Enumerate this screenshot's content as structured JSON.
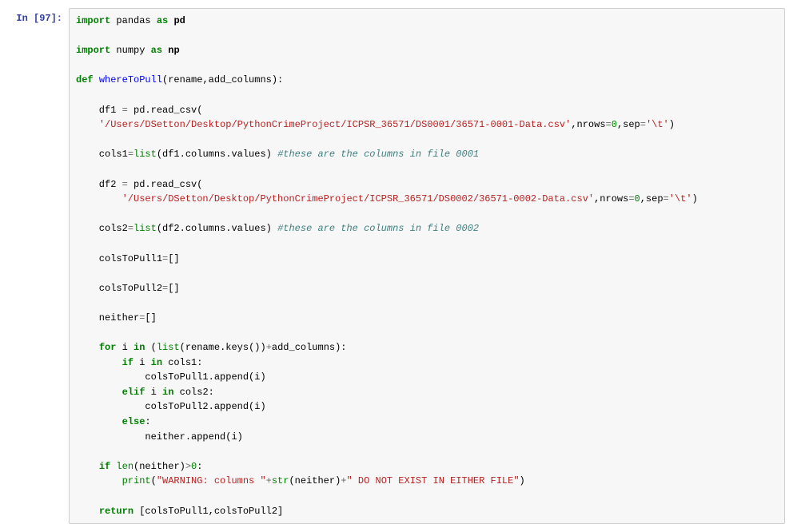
{
  "prompt": "In [97]:",
  "code": {
    "line1_import": "import",
    "line1_pandas": "pandas",
    "line1_as": "as",
    "line1_pd": "pd",
    "line2_import": "import",
    "line2_numpy": "numpy",
    "line2_as": "as",
    "line2_np": "np",
    "def": "def",
    "funcname": "whereToPull",
    "params": "(rename,add_columns):",
    "df1_assign": "    df1 ",
    "eq": "=",
    "pd_read_csv": " pd",
    "dot_read_csv": ".read_csv(",
    "path1": "'/Users/DSetton/Desktop/PythonCrimeProject/ICPSR_36571/DS0001/36571-0001-Data.csv'",
    "nrows": ",nrows",
    "zero": "0",
    "sep": ",sep",
    "tab": "'\\t'",
    "close_paren": ")",
    "cols1_assign": "    cols1",
    "list": "list",
    "df1_cols": "(df1",
    "dot_columns": ".columns",
    "dot_values": ".values) ",
    "comment1": "#these are the columns in file 0001",
    "df2_assign": "    df2 ",
    "path2": "'/Users/DSetton/Desktop/PythonCrimeProject/ICPSR_36571/DS0002/36571-0002-Data.csv'",
    "cols2_assign": "    cols2",
    "df2_cols": "(df2",
    "comment2": "#these are the columns in file 0002",
    "colsToPull1": "    colsToPull1",
    "empty_list": "[]",
    "colsToPull2": "    colsToPull2",
    "neither": "    neither",
    "for": "for",
    "i_in": " i ",
    "in": "in",
    "for_iter_open": " (",
    "rename_keys": "(rename",
    "dot_keys": ".keys())",
    "plus": "+",
    "add_columns": "add_columns):",
    "if": "if",
    "i_in_cols1": " i ",
    "cols1_colon": " cols1:",
    "append1_indent": "            colsToPull1",
    "dot_append": ".append(i)",
    "elif": "elif",
    "cols2_colon": " cols2:",
    "append2_indent": "            colsToPull2",
    "else": "else",
    "else_colon": ":",
    "neither_append": "            neither",
    "len": "len",
    "neither_gt": "(neither)",
    "gt": ">",
    "zero_colon": "0",
    "colon": ":",
    "print": "print",
    "warn1": "\"WARNING: columns \"",
    "str_fn": "str",
    "neither_arg": "(neither)",
    "warn2": "\" DO NOT EXIST IN EITHER FILE\"",
    "return": "return",
    "return_val": " [colsToPull1,colsToPull2]"
  }
}
